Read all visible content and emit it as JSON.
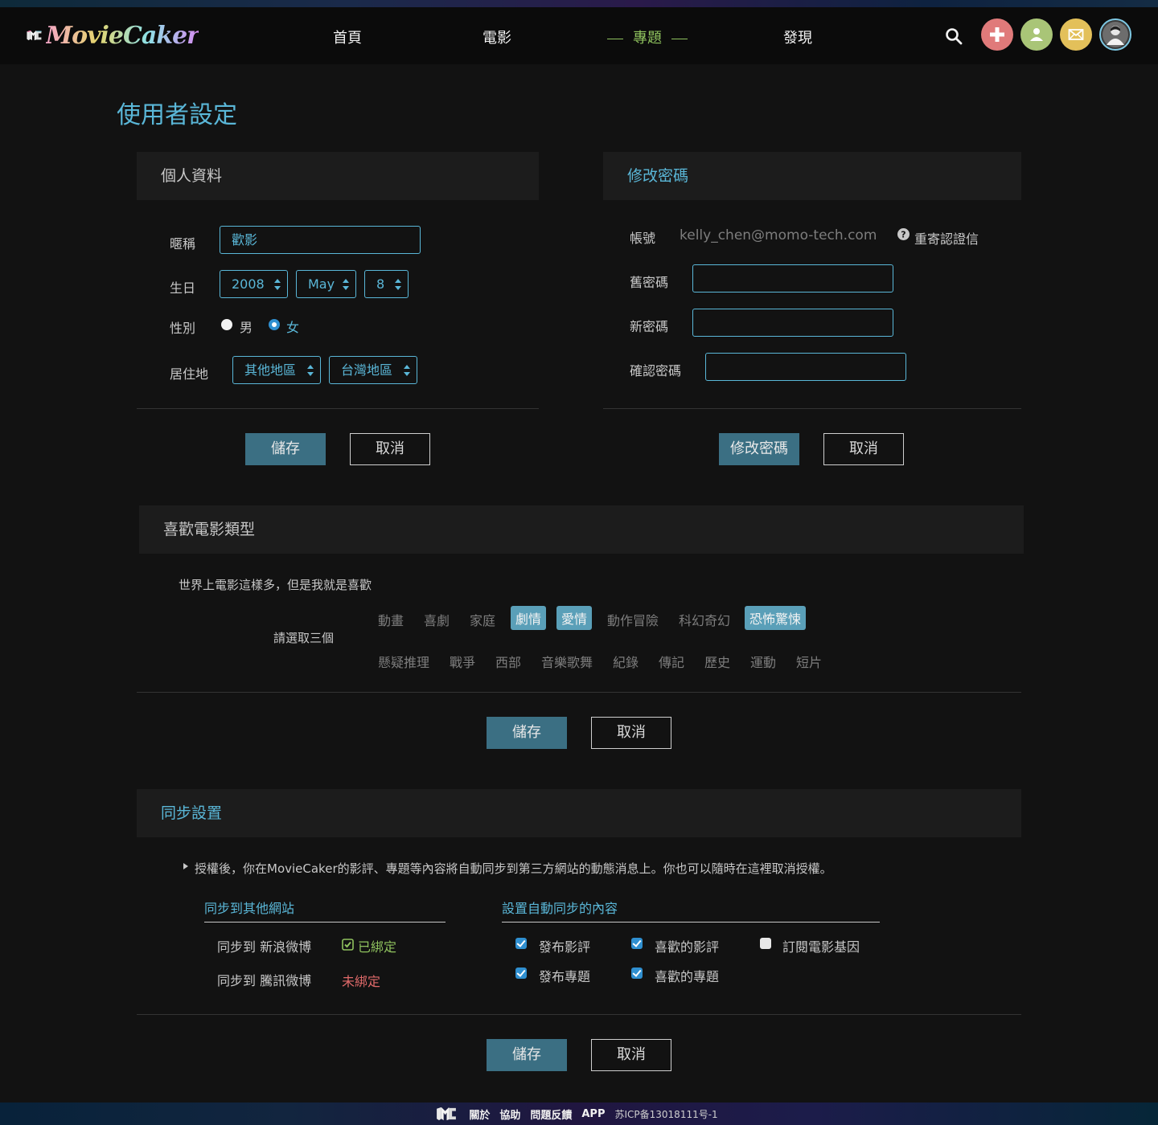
{
  "header": {
    "logo_text": "MovieCaker",
    "nav": [
      "首頁",
      "電影",
      "專題",
      "發現"
    ],
    "active_nav": "專題"
  },
  "page_title": "使用者設定",
  "profile": {
    "title": "個人資料",
    "nickname_label": "暱稱",
    "nickname_value": "歡影",
    "birthday_label": "生日",
    "year": "2008",
    "month": "May",
    "day": "8",
    "gender_label": "性別",
    "male": "男",
    "female": "女",
    "gender_selected": "女",
    "residence_label": "居住地",
    "region1": "其他地區",
    "region2": "台灣地區",
    "save": "儲存",
    "cancel": "取消"
  },
  "password": {
    "title": "修改密碼",
    "account_label": "帳號",
    "account_value": "kelly_chen@momo-tech.com",
    "resend": "重寄認證信",
    "old_label": "舊密碼",
    "new_label": "新密碼",
    "confirm_label": "確認密碼",
    "submit": "修改密碼",
    "cancel": "取消"
  },
  "genres": {
    "title": "喜歡電影類型",
    "intro": "世界上電影這樣多，但是我就是喜歡",
    "hint": "請選取三個",
    "row1": [
      "動畫",
      "喜劇",
      "家庭",
      "劇情",
      "愛情",
      "動作冒險",
      "科幻奇幻",
      "恐怖驚悚"
    ],
    "row2": [
      "懸疑推理",
      "戰爭",
      "西部",
      "音樂歌舞",
      "紀錄",
      "傳記",
      "歷史",
      "運動",
      "短片"
    ],
    "selected": [
      "劇情",
      "愛情",
      "恐怖驚悚"
    ],
    "save": "儲存",
    "cancel": "取消"
  },
  "sync": {
    "title": "同步設置",
    "note": "授權後，你在MovieCaker的影評、專題等內容將自動同步到第三方網站的動態消息上。你也可以隨時在這裡取消授權。",
    "sites_head": "同步到其他網站",
    "content_head": "設置自動同步的內容",
    "sites": [
      {
        "name": "同步到 新浪微博",
        "status": "已綁定",
        "bound": true
      },
      {
        "name": "同步到 騰訊微博",
        "status": "未綁定",
        "bound": false
      }
    ],
    "options": [
      {
        "label": "發布影評",
        "checked": true
      },
      {
        "label": "喜歡的影評",
        "checked": true
      },
      {
        "label": "訂閱電影基因",
        "checked": false
      },
      {
        "label": "發布專題",
        "checked": true
      },
      {
        "label": "喜歡的專題",
        "checked": true
      }
    ],
    "save": "儲存",
    "cancel": "取消"
  },
  "footer": {
    "links": [
      "關於",
      "協助",
      "問題反饋",
      "APP"
    ],
    "icp": "苏ICP备13018111号-1"
  },
  "colors": {
    "accent": "#5ab7d8",
    "active_nav": "#8fc25e",
    "primary_button": "#3b6f83",
    "bound": "#8fc25e",
    "unbound": "#e06a6a"
  }
}
